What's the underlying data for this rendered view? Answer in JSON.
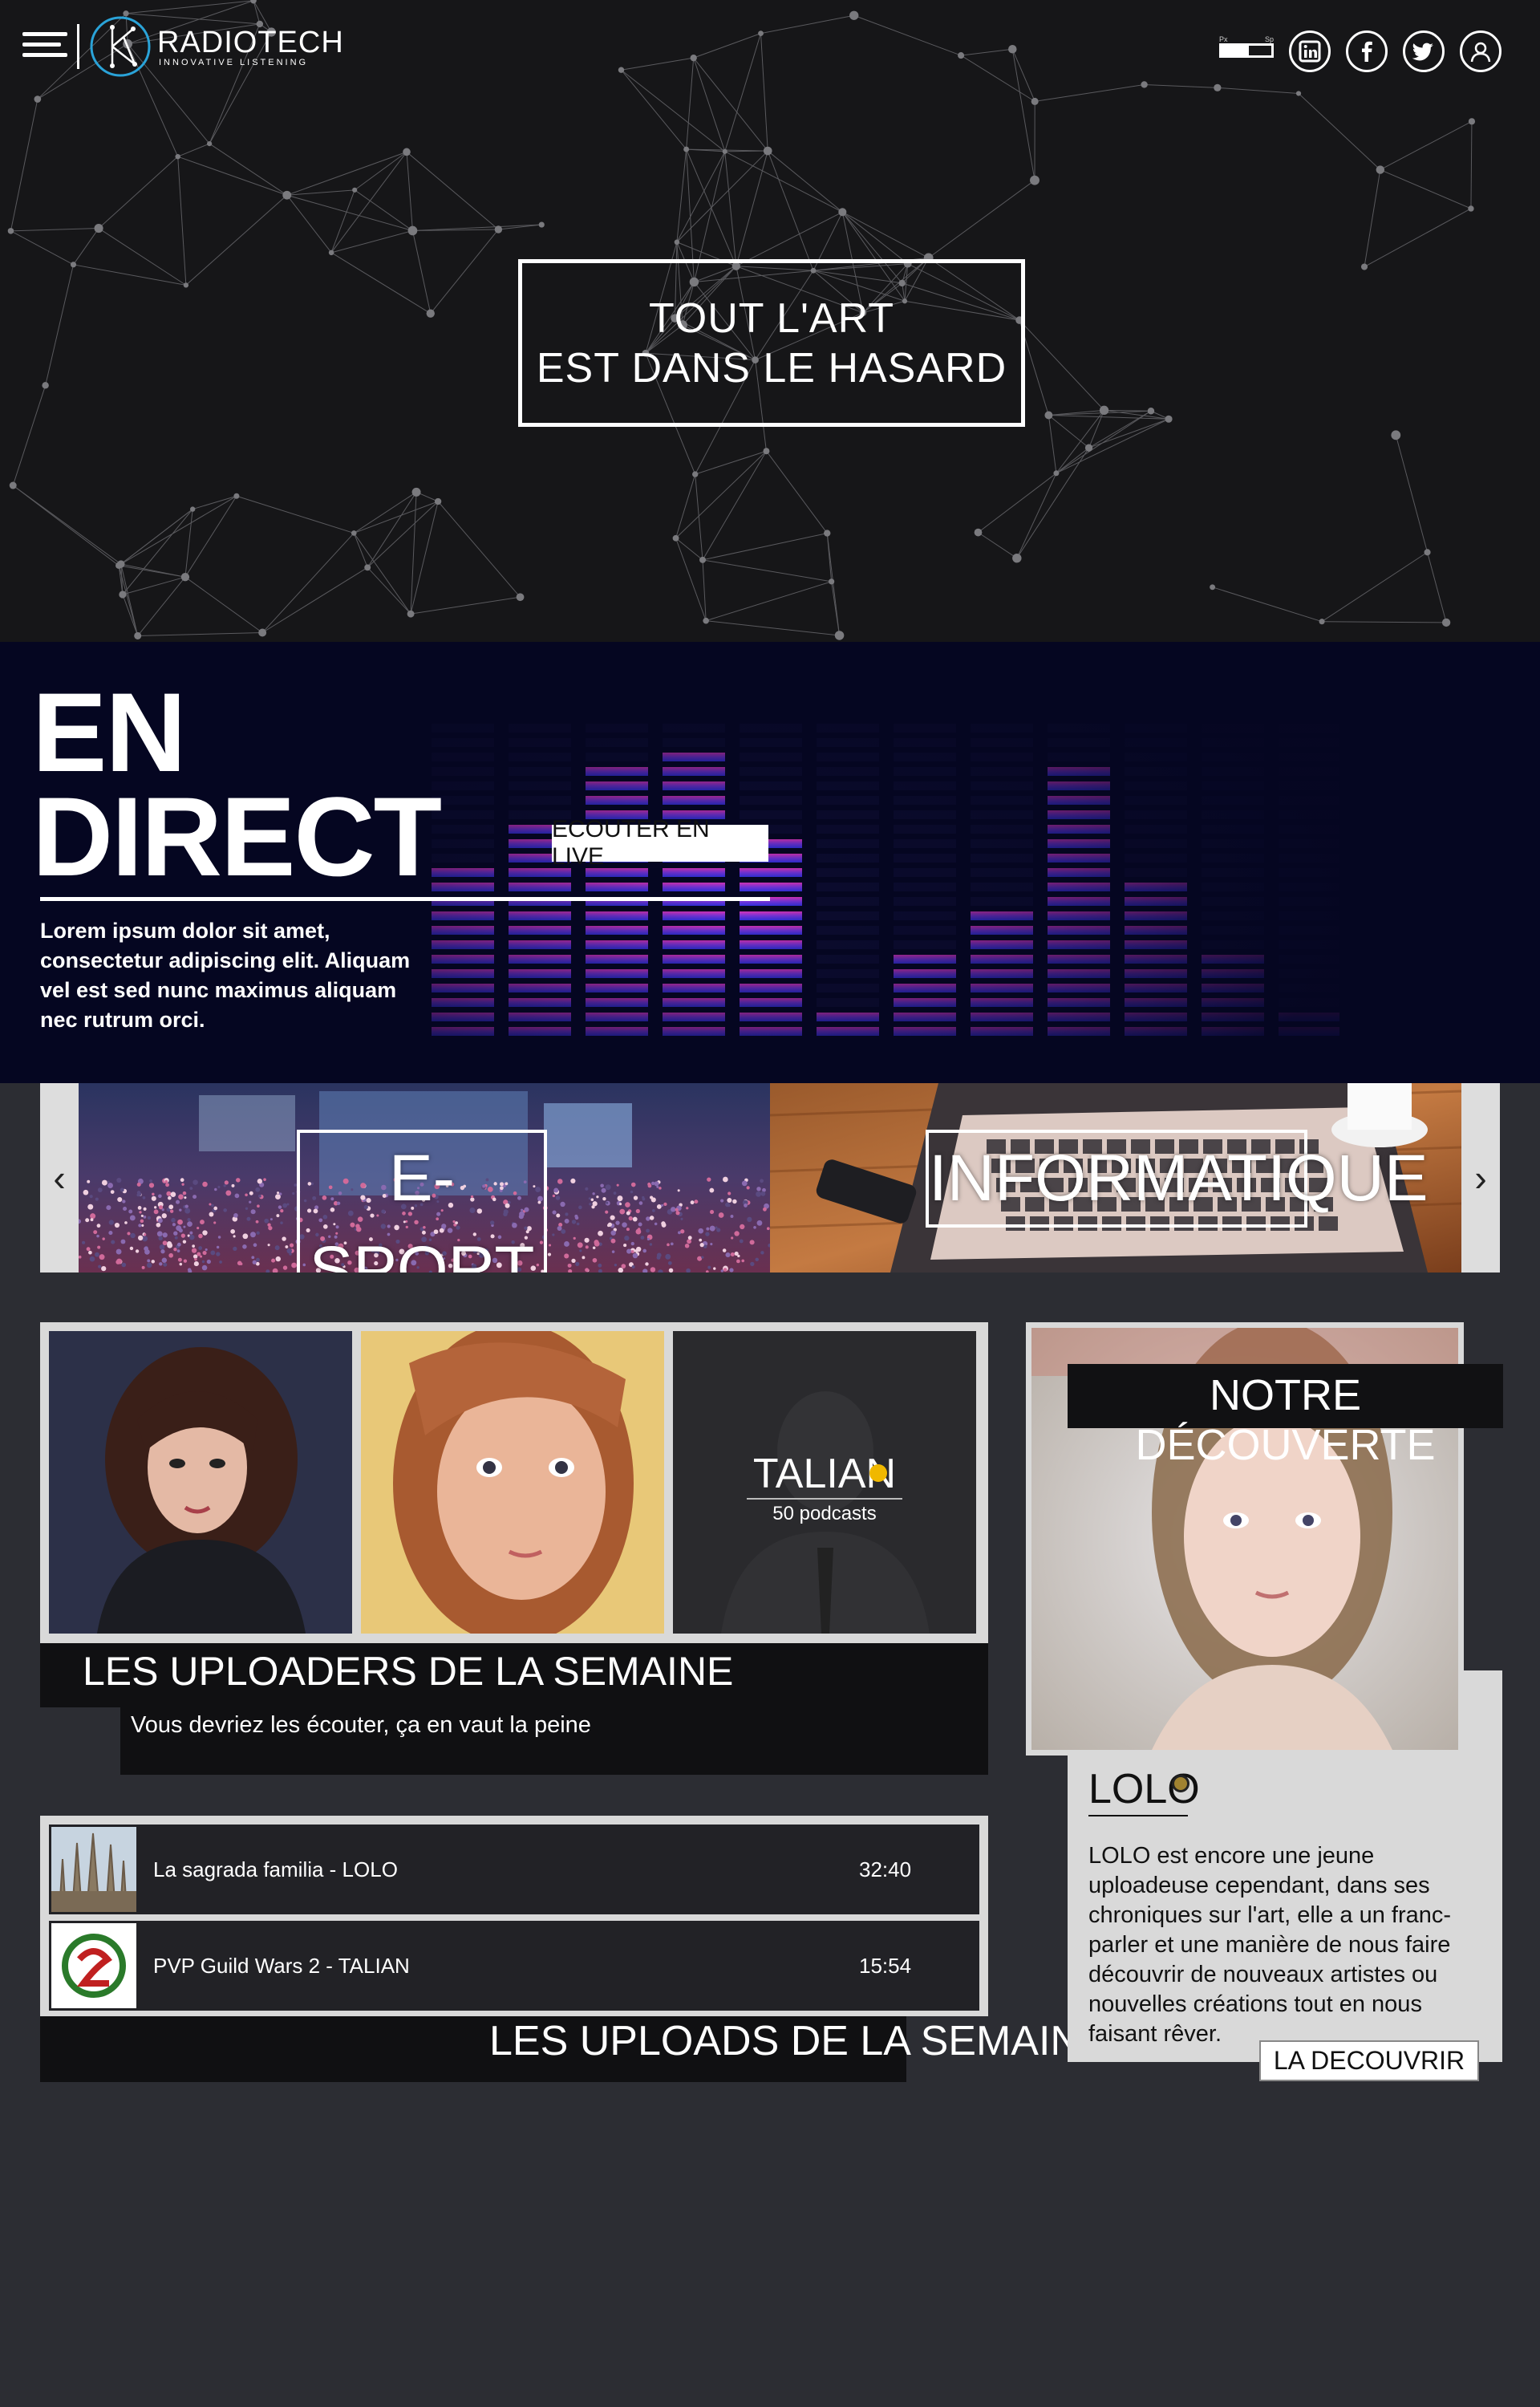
{
  "header": {
    "brand_name": "RADIOTECH",
    "brand_tagline": "INNOVATIVE LISTENING",
    "volume": {
      "low_label": "Px",
      "high_label": "Sp",
      "level_fraction": 0.55
    },
    "social": [
      "linkedin-icon",
      "facebook-icon",
      "twitter-icon",
      "user-icon"
    ]
  },
  "hero": {
    "line1": "TOUT L'ART",
    "line2": "EST DANS LE HASARD"
  },
  "live": {
    "title_line1": "EN",
    "title_line2": "DIRECT",
    "button_label": "ECOUTER EN LIVE",
    "description": "Lorem ipsum dolor sit amet, consectetur adipiscing elit. Aliquam vel est sed nunc maximus aliquam nec rutrum orci."
  },
  "categories": {
    "prev_icon": "chevron-left-icon",
    "next_icon": "chevron-right-icon",
    "items": [
      {
        "label": "E-SPORT"
      },
      {
        "label": "INFORMATIQUE"
      }
    ]
  },
  "uploaders": {
    "title": "LES UPLOADERS DE LA SEMAINE",
    "subtitle": "Vous devriez les écouter, ça en vaut la peine",
    "featured": {
      "name": "TALIAN",
      "count_label": "50 podcasts"
    }
  },
  "uploads": {
    "title": "LES UPLOADS DE LA SEMAINE",
    "rows": [
      {
        "title": "La sagrada familia - LOLO",
        "duration": "32:40"
      },
      {
        "title": "PVP Guild Wars 2 - TALIAN",
        "duration": "15:54"
      }
    ]
  },
  "discovery": {
    "label": "NOTRE DÉCOUVERTE",
    "name": "LOLO",
    "description": "LOLO est encore une jeune uploadeuse cependant, dans ses chroniques sur l'art, elle a un franc-parler et une manière de nous faire découvrir de nouveaux artistes ou nouvelles créations tout en nous faisant rêver.",
    "button_label": "LA DECOUVRIR"
  },
  "colors": {
    "page_bg": "#2c2d33",
    "hero_bg": "#161618",
    "live_bg": "#050621",
    "accent_yellow": "#f0b800"
  }
}
